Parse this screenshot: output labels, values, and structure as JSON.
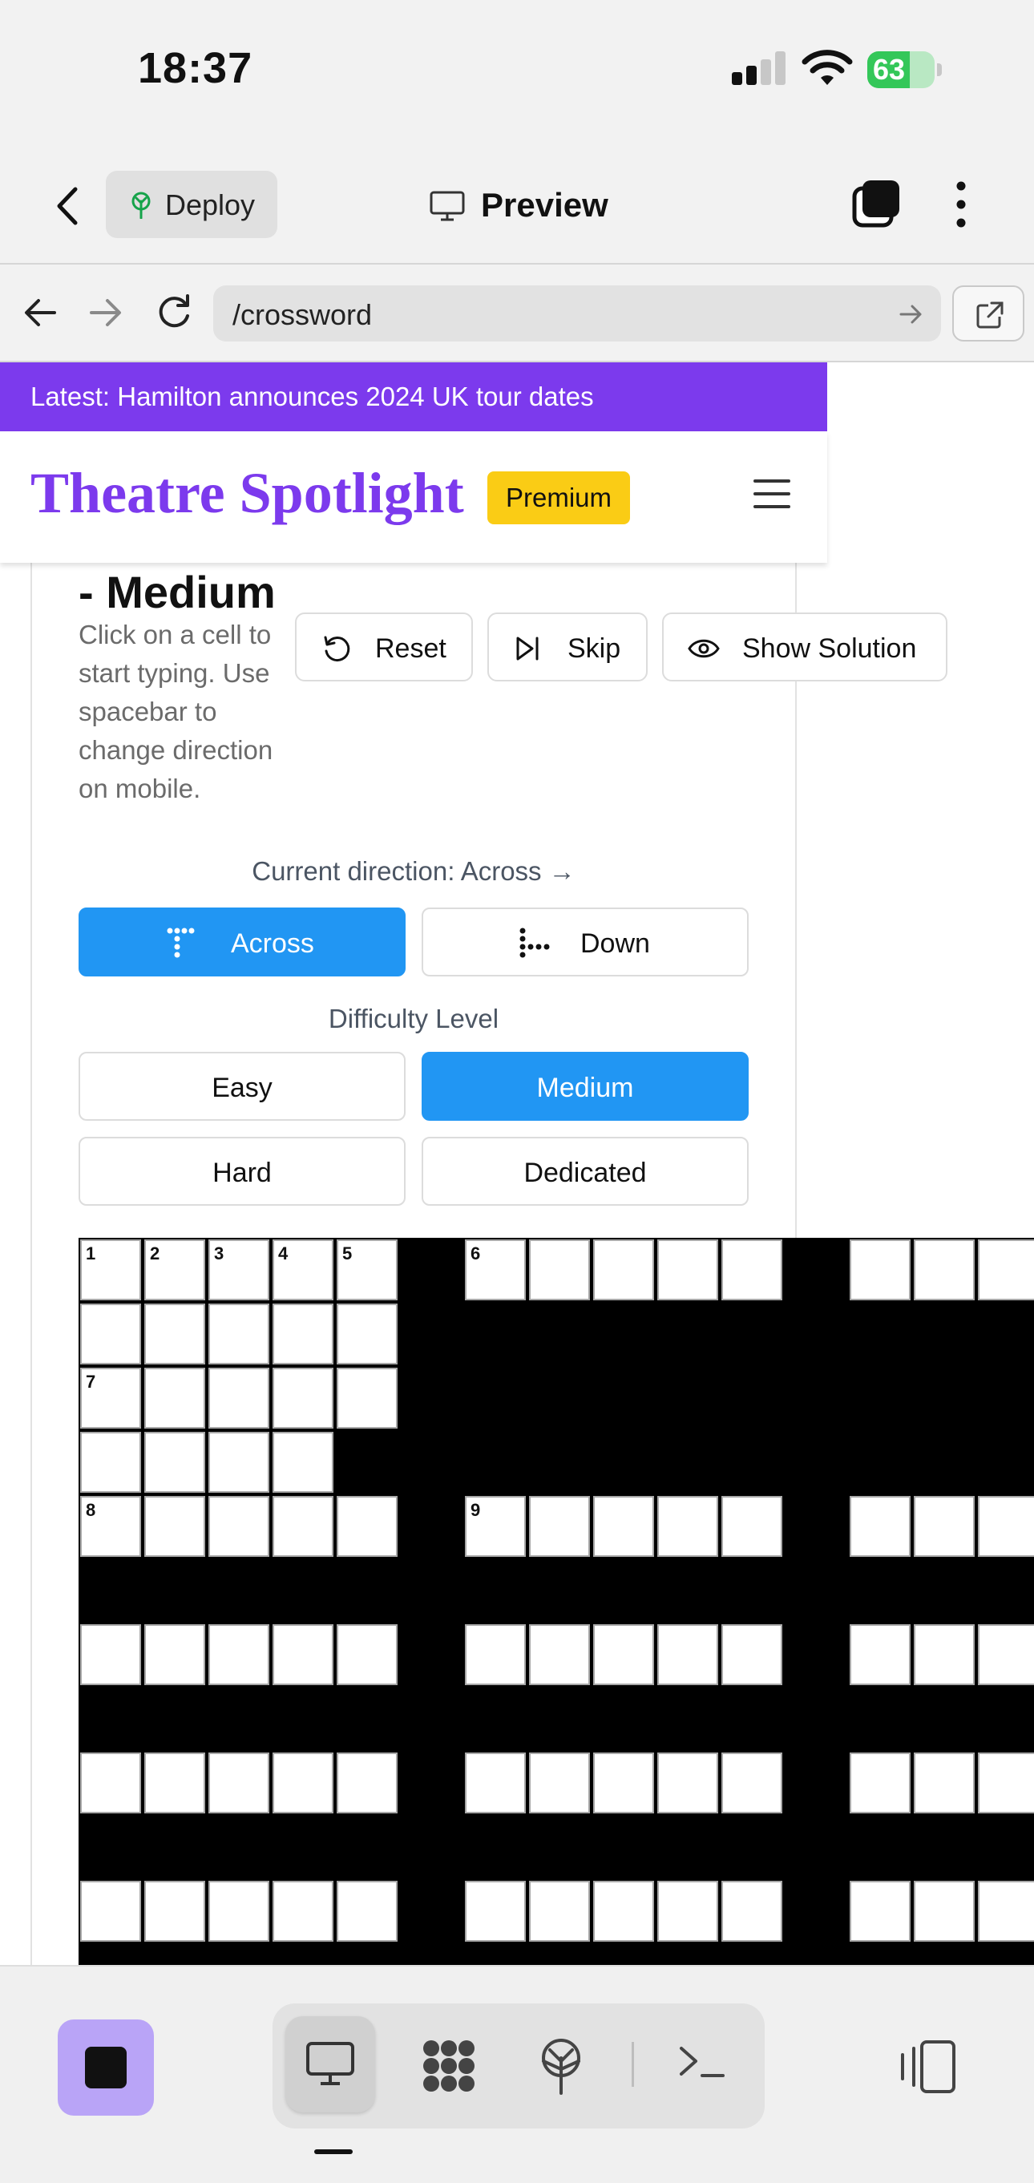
{
  "status_bar": {
    "time": "18:37",
    "battery_percent": "63",
    "battery_level": 0.63
  },
  "app_header": {
    "deploy_label": "Deploy",
    "preview_label": "Preview"
  },
  "url_bar": {
    "url": "/crossword"
  },
  "site": {
    "news_banner": "Latest: Hamilton announces 2024 UK tour dates",
    "logo": "Theatre Spotlight",
    "premium_badge": "Premium",
    "brand_color": "#7c3aed",
    "accent_color": "#2196f3"
  },
  "puzzle": {
    "title": "- Medium",
    "help_text": "Click on a cell to start typing. Use spacebar to change direction on mobile.",
    "tools": {
      "reset_label": "Reset",
      "skip_label": "Skip",
      "solution_label": "Show Solution"
    },
    "direction_text": "Current direction: Across →",
    "direction_buttons": {
      "across_label": "Across",
      "down_label": "Down",
      "active": "Across"
    },
    "difficulty": {
      "label": "Difficulty Level",
      "options": [
        "Easy",
        "Medium",
        "Hard",
        "Dedicated"
      ],
      "selected": "Medium"
    },
    "grid": {
      "numbers": {
        "1": "1",
        "2": "2",
        "3": "3",
        "4": "4",
        "5": "5",
        "6": "6",
        "7": "7",
        "8": "8",
        "9": "9"
      }
    }
  },
  "bottom_toolbar": {
    "modes": [
      "desktop-preview",
      "components",
      "deploy",
      "terminal"
    ],
    "selected_mode": "desktop-preview"
  }
}
